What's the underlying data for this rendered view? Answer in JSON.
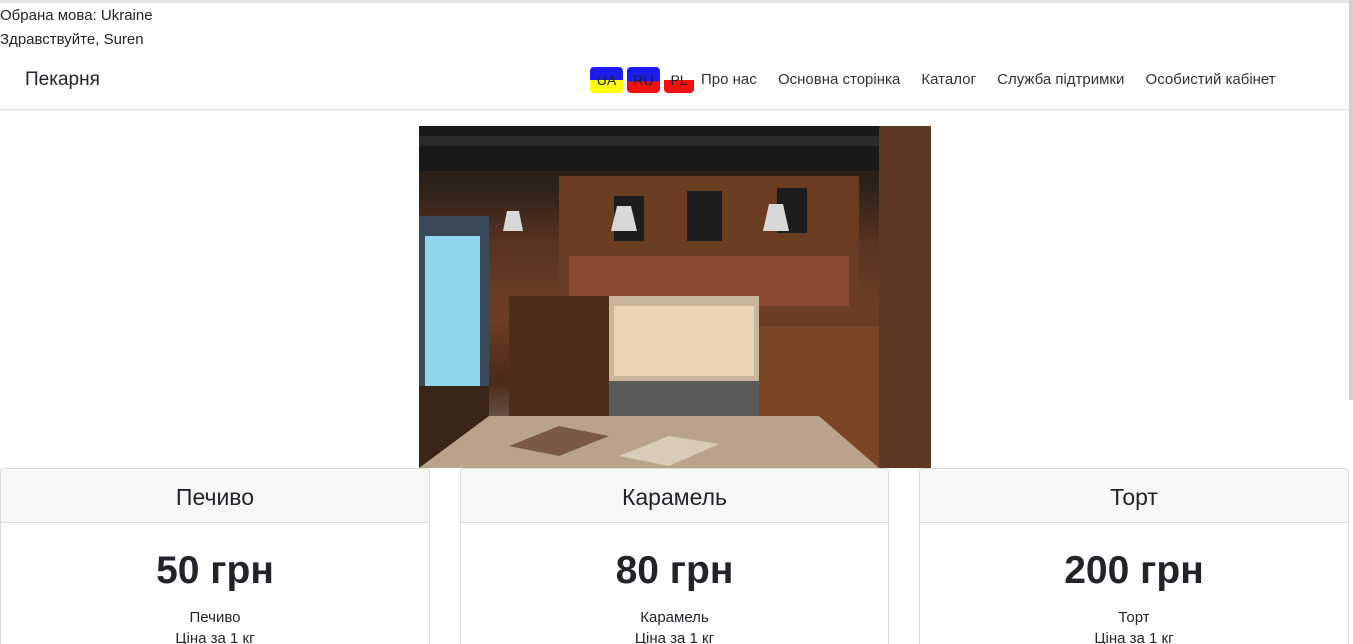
{
  "language_info": "Обрана мова: Ukraine",
  "greeting": "Здравствуйте, Suren",
  "navbar": {
    "brand": "Пекарня",
    "languages": [
      {
        "code": "UA"
      },
      {
        "code": "RU"
      },
      {
        "code": "PL"
      }
    ],
    "links": [
      {
        "label": "Про нас"
      },
      {
        "label": "Основна сторінка"
      },
      {
        "label": "Каталог"
      },
      {
        "label": "Служба підтримки"
      },
      {
        "label": "Особистий кабінет"
      }
    ]
  },
  "products": [
    {
      "header": "Печиво",
      "price": "50 грн",
      "name": "Печиво",
      "note": "Ціна за 1 кг"
    },
    {
      "header": "Карамель",
      "price": "80 грн",
      "name": "Карамель",
      "note": "Ціна за 1 кг"
    },
    {
      "header": "Торт",
      "price": "200 грн",
      "name": "Торт",
      "note": "Ціна за 1 кг"
    }
  ],
  "colors": {
    "flag_ua": [
      "#1c1cf0",
      "#ffff00"
    ],
    "flag_ru": [
      "#1c1cf0",
      "#f01010"
    ],
    "flag_pl": [
      "#ffffff",
      "#f01010"
    ]
  }
}
